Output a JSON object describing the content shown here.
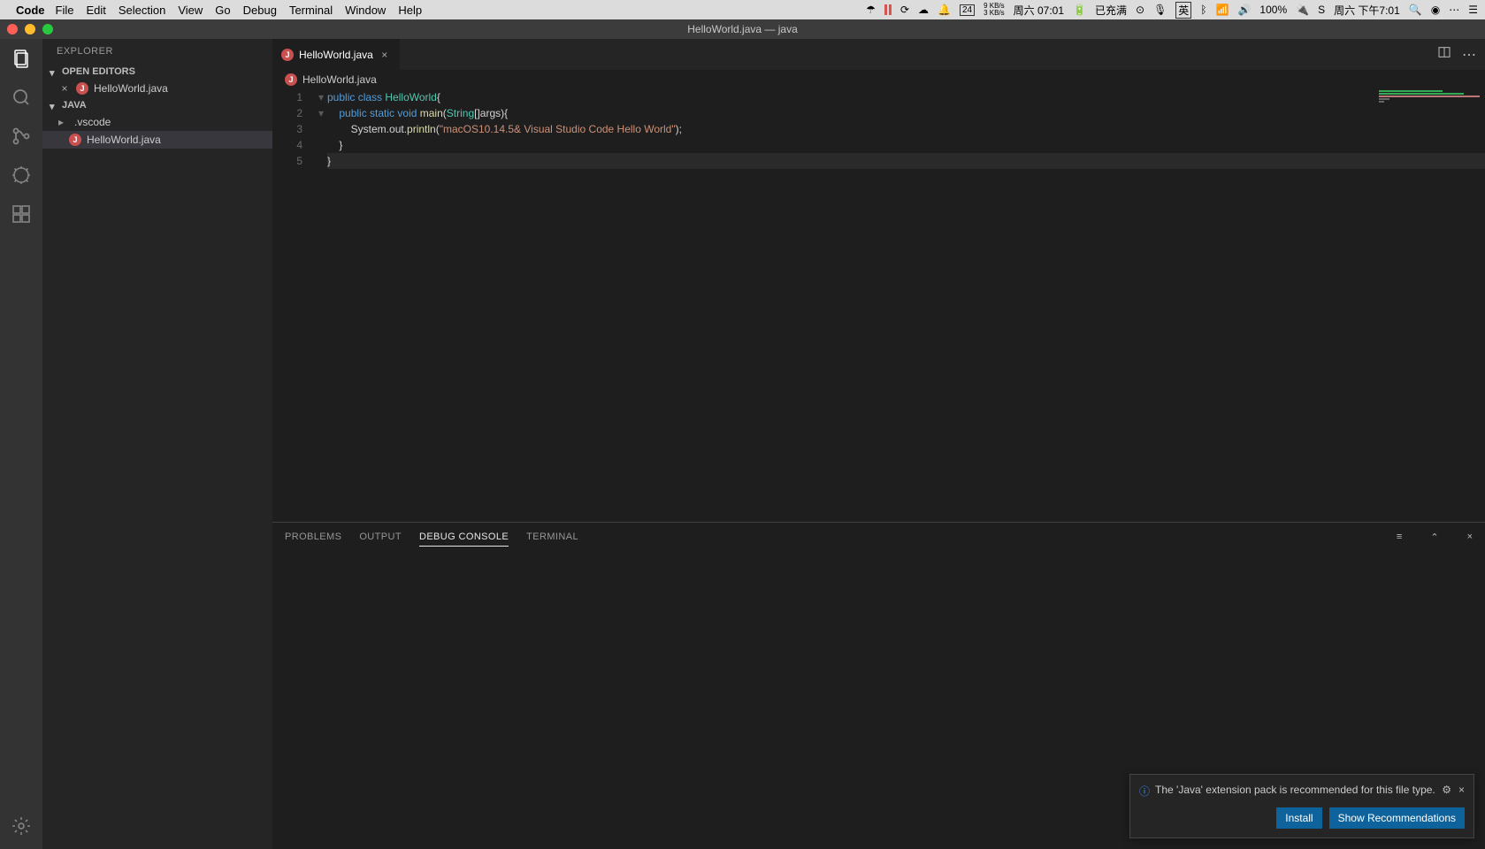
{
  "mac": {
    "app": "Code",
    "menus": [
      "File",
      "Edit",
      "Selection",
      "View",
      "Go",
      "Debug",
      "Terminal",
      "Window",
      "Help"
    ],
    "net_up": "9 KB/s",
    "net_down": "3 KB/s",
    "date_left": "周六 07:01",
    "power": "已充满",
    "battery": "100%",
    "date_right": "周六 下午7:01",
    "cal_day": "24"
  },
  "win_title": "HelloWorld.java — java",
  "explorer": {
    "title": "EXPLORER",
    "open_editors": "OPEN EDITORS",
    "root": "JAVA",
    "items": {
      "open0": "HelloWorld.java",
      "folder0": ".vscode",
      "file0": "HelloWorld.java"
    }
  },
  "tab": {
    "name": "HelloWorld.java"
  },
  "breadcrumb": "HelloWorld.java",
  "code": {
    "l1": {
      "kw1": "public",
      "kw2": "class",
      "cls": "HelloWorld",
      "tail": "{"
    },
    "l2": {
      "kw1": "public",
      "kw2": "static",
      "kw3": "void",
      "met": "main",
      "p1": "(",
      "ty": "String",
      "p2": "[]args){"
    },
    "l3": {
      "obj": "System.out.",
      "met": "println",
      "p1": "(",
      "str": "\"macOS10.14.5& Visual Studio Code Hello World\"",
      "p2": ");"
    },
    "l4": "    }",
    "l5": "}"
  },
  "lines": [
    "1",
    "2",
    "3",
    "4",
    "5"
  ],
  "panel": {
    "tabs": [
      "PROBLEMS",
      "OUTPUT",
      "DEBUG CONSOLE",
      "TERMINAL"
    ]
  },
  "notif": {
    "text": "The 'Java' extension pack is recommended for this file type.",
    "install": "Install",
    "show": "Show Recommendations"
  }
}
